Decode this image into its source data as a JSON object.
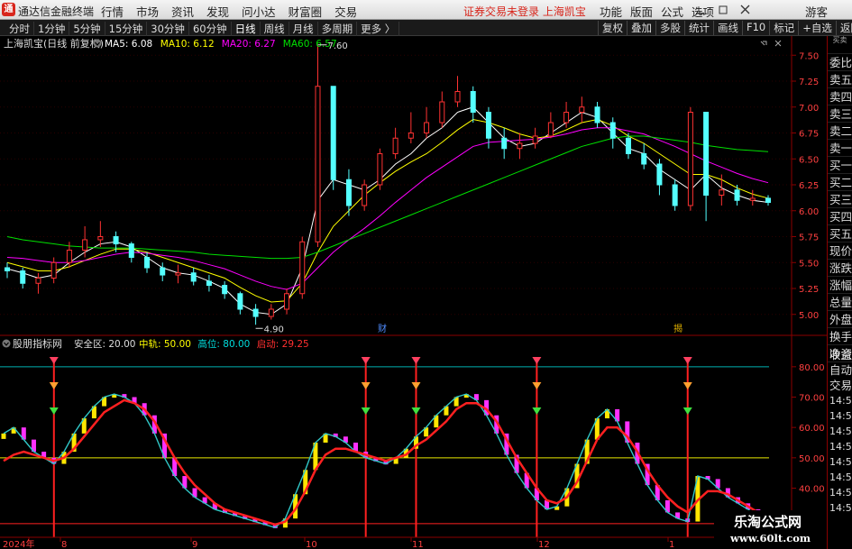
{
  "app": {
    "title": "通达信金融终端",
    "logo_char": "通"
  },
  "menu": [
    "行情",
    "市场",
    "资讯",
    "发现",
    "问小达",
    "财富圈",
    "交易"
  ],
  "status": {
    "text": "证券交易未登录  上海凯宝"
  },
  "right_menu": [
    "功能",
    "版面",
    "公式",
    "选项"
  ],
  "guest": "游客",
  "periods": [
    {
      "label": "分时",
      "active": false
    },
    {
      "label": "1分钟",
      "active": false
    },
    {
      "label": "5分钟",
      "active": false
    },
    {
      "label": "15分钟",
      "active": false
    },
    {
      "label": "30分钟",
      "active": false
    },
    {
      "label": "60分钟",
      "active": false
    },
    {
      "label": "日线",
      "active": true
    },
    {
      "label": "周线",
      "active": false
    },
    {
      "label": "月线",
      "active": false
    },
    {
      "label": "多周期",
      "active": false
    },
    {
      "label": "更多 〉",
      "active": false
    }
  ],
  "toolbar_right": [
    "复权",
    "叠加",
    "多股",
    "统计",
    "画线",
    "F10",
    "标记",
    "+自选",
    "返回"
  ],
  "price_panel": {
    "stock": "上海凯宝(日线 前复权)",
    "ma": [
      {
        "label": "MA5: 6.08",
        "color": "#ffffff"
      },
      {
        "label": "MA10: 6.12",
        "color": "#ffff00"
      },
      {
        "label": "MA20: 6.27",
        "color": "#ff00ff"
      },
      {
        "label": "MA60: 6.57",
        "color": "#00e000"
      }
    ],
    "high_label": "7.60",
    "low_label": "4.90",
    "markers": [
      "财",
      "揭"
    ],
    "yticks": [
      "7.50",
      "7.25",
      "7.00",
      "6.75",
      "6.50",
      "6.25",
      "6.00",
      "5.75",
      "5.50",
      "5.25",
      "5.00"
    ]
  },
  "indicator_panel": {
    "name": "股朋指标网",
    "params": [
      {
        "label": "安全区: 20.00",
        "color": "#dddddd"
      },
      {
        "label": "中轨: 50.00",
        "color": "#ffff00"
      },
      {
        "label": "高位: 80.00",
        "color": "#00dddd"
      },
      {
        "label": "启动: 29.25",
        "color": "#ff3030"
      }
    ],
    "yticks": [
      "80.00",
      "70.00",
      "60.00",
      "50.00",
      "40.00",
      "30.00"
    ]
  },
  "xaxis": [
    "2024年",
    "8",
    "9",
    "10",
    "11",
    "12",
    "1"
  ],
  "sidebar": {
    "top": "买卖",
    "items": [
      "委比",
      "卖五",
      "卖四",
      "卖三",
      "卖二",
      "卖一",
      "买一",
      "买二",
      "买三",
      "买四",
      "买五",
      "现价",
      "涨跌",
      "涨幅",
      "总量",
      "外盘",
      "换手",
      "净资",
      "收益"
    ],
    "lower": [
      "自动",
      "交易"
    ],
    "times": [
      "14:56",
      "14:56",
      "14:56",
      "14:56",
      "14:56",
      "14:56",
      "14:56",
      "14:56",
      "14:56"
    ]
  },
  "watermark": {
    "line1": "乐淘公式网",
    "line2": "www.60lt.com"
  },
  "chart_data": [
    {
      "type": "candlestick",
      "title": "上海凯宝(日线 前复权)",
      "ylim": [
        4.85,
        7.65
      ],
      "annotations": [
        {
          "text": "7.60",
          "point": "high"
        },
        {
          "text": "4.90",
          "point": "low"
        }
      ],
      "series": [
        {
          "name": "MA5",
          "color": "#ffffff",
          "values": [
            5.44,
            5.4,
            5.35,
            5.38,
            5.5,
            5.6,
            5.68,
            5.7,
            5.65,
            5.55,
            5.45,
            5.4,
            5.38,
            5.32,
            5.25,
            5.1,
            5.02,
            5.0,
            5.1,
            5.45,
            6.1,
            6.3,
            6.25,
            6.2,
            6.3,
            6.45,
            6.55,
            6.7,
            6.8,
            6.95,
            7.0,
            6.85,
            6.7,
            6.62,
            6.65,
            6.75,
            6.85,
            6.95,
            6.9,
            6.75,
            6.6,
            6.55,
            6.4,
            6.3,
            6.2,
            6.35,
            6.22,
            6.15,
            6.1,
            6.08
          ]
        },
        {
          "name": "MA10",
          "color": "#ffff00",
          "values": [
            5.5,
            5.46,
            5.42,
            5.42,
            5.46,
            5.52,
            5.58,
            5.63,
            5.63,
            5.6,
            5.55,
            5.5,
            5.45,
            5.4,
            5.35,
            5.26,
            5.18,
            5.12,
            5.13,
            5.3,
            5.6,
            5.85,
            6.0,
            6.15,
            6.27,
            6.38,
            6.47,
            6.55,
            6.66,
            6.78,
            6.88,
            6.85,
            6.8,
            6.74,
            6.7,
            6.72,
            6.78,
            6.85,
            6.88,
            6.82,
            6.72,
            6.65,
            6.55,
            6.45,
            6.35,
            6.35,
            6.3,
            6.22,
            6.16,
            6.12
          ]
        },
        {
          "name": "MA20",
          "color": "#ff00ff",
          "values": [
            5.55,
            5.54,
            5.52,
            5.5,
            5.5,
            5.52,
            5.55,
            5.58,
            5.6,
            5.59,
            5.57,
            5.55,
            5.52,
            5.48,
            5.44,
            5.38,
            5.32,
            5.27,
            5.24,
            5.3,
            5.45,
            5.6,
            5.72,
            5.83,
            5.95,
            6.08,
            6.2,
            6.32,
            6.42,
            6.52,
            6.62,
            6.66,
            6.67,
            6.68,
            6.69,
            6.71,
            6.74,
            6.78,
            6.8,
            6.8,
            6.77,
            6.74,
            6.68,
            6.62,
            6.55,
            6.48,
            6.42,
            6.36,
            6.31,
            6.27
          ]
        },
        {
          "name": "MA60",
          "color": "#00e000",
          "values": [
            5.75,
            5.72,
            5.7,
            5.68,
            5.66,
            5.65,
            5.64,
            5.64,
            5.64,
            5.63,
            5.62,
            5.61,
            5.6,
            5.58,
            5.57,
            5.56,
            5.55,
            5.54,
            5.54,
            5.55,
            5.6,
            5.66,
            5.72,
            5.78,
            5.84,
            5.9,
            5.96,
            6.02,
            6.08,
            6.14,
            6.2,
            6.26,
            6.32,
            6.38,
            6.44,
            6.5,
            6.56,
            6.62,
            6.66,
            6.7,
            6.72,
            6.72,
            6.7,
            6.68,
            6.66,
            6.63,
            6.61,
            6.59,
            6.58,
            6.57
          ]
        }
      ],
      "candles": [
        {
          "o": 5.45,
          "c": 5.42,
          "h": 5.5,
          "l": 5.35
        },
        {
          "o": 5.42,
          "c": 5.3,
          "h": 5.45,
          "l": 5.25
        },
        {
          "o": 5.3,
          "c": 5.35,
          "h": 5.4,
          "l": 5.2
        },
        {
          "o": 5.35,
          "c": 5.5,
          "h": 5.55,
          "l": 5.3
        },
        {
          "o": 5.5,
          "c": 5.62,
          "h": 5.7,
          "l": 5.45
        },
        {
          "o": 5.62,
          "c": 5.72,
          "h": 5.85,
          "l": 5.55
        },
        {
          "o": 5.72,
          "c": 5.75,
          "h": 5.9,
          "l": 5.65
        },
        {
          "o": 5.75,
          "c": 5.68,
          "h": 5.8,
          "l": 5.6
        },
        {
          "o": 5.68,
          "c": 5.55,
          "h": 5.7,
          "l": 5.5
        },
        {
          "o": 5.55,
          "c": 5.45,
          "h": 5.6,
          "l": 5.4
        },
        {
          "o": 5.45,
          "c": 5.38,
          "h": 5.5,
          "l": 5.32
        },
        {
          "o": 5.38,
          "c": 5.4,
          "h": 5.48,
          "l": 5.3
        },
        {
          "o": 5.4,
          "c": 5.32,
          "h": 5.45,
          "l": 5.28
        },
        {
          "o": 5.32,
          "c": 5.28,
          "h": 5.38,
          "l": 5.22
        },
        {
          "o": 5.28,
          "c": 5.2,
          "h": 5.32,
          "l": 5.15
        },
        {
          "o": 5.2,
          "c": 5.05,
          "h": 5.22,
          "l": 5.0
        },
        {
          "o": 5.05,
          "c": 4.98,
          "h": 5.1,
          "l": 4.9
        },
        {
          "o": 4.98,
          "c": 5.05,
          "h": 5.1,
          "l": 4.95
        },
        {
          "o": 5.05,
          "c": 5.2,
          "h": 5.25,
          "l": 5.0
        },
        {
          "o": 5.2,
          "c": 5.7,
          "h": 5.75,
          "l": 5.15
        },
        {
          "o": 5.7,
          "c": 7.2,
          "h": 7.6,
          "l": 5.65
        },
        {
          "o": 7.2,
          "c": 6.3,
          "h": 7.2,
          "l": 6.2
        },
        {
          "o": 6.3,
          "c": 6.05,
          "h": 6.4,
          "l": 5.95
        },
        {
          "o": 6.05,
          "c": 6.25,
          "h": 6.3,
          "l": 6.0
        },
        {
          "o": 6.25,
          "c": 6.55,
          "h": 6.6,
          "l": 6.2
        },
        {
          "o": 6.55,
          "c": 6.7,
          "h": 6.8,
          "l": 6.5
        },
        {
          "o": 6.7,
          "c": 6.75,
          "h": 6.95,
          "l": 6.65
        },
        {
          "o": 6.75,
          "c": 6.85,
          "h": 7.0,
          "l": 6.7
        },
        {
          "o": 6.85,
          "c": 7.05,
          "h": 7.15,
          "l": 6.8
        },
        {
          "o": 7.05,
          "c": 7.15,
          "h": 7.3,
          "l": 7.0
        },
        {
          "o": 7.15,
          "c": 6.95,
          "h": 7.2,
          "l": 6.85
        },
        {
          "o": 6.95,
          "c": 6.7,
          "h": 7.0,
          "l": 6.6
        },
        {
          "o": 6.7,
          "c": 6.6,
          "h": 6.8,
          "l": 6.5
        },
        {
          "o": 6.6,
          "c": 6.65,
          "h": 6.75,
          "l": 6.5
        },
        {
          "o": 6.65,
          "c": 6.72,
          "h": 6.8,
          "l": 6.6
        },
        {
          "o": 6.72,
          "c": 6.85,
          "h": 6.95,
          "l": 6.7
        },
        {
          "o": 6.85,
          "c": 6.95,
          "h": 7.05,
          "l": 6.8
        },
        {
          "o": 6.95,
          "c": 7.0,
          "h": 7.1,
          "l": 6.85
        },
        {
          "o": 7.0,
          "c": 6.85,
          "h": 7.05,
          "l": 6.8
        },
        {
          "o": 6.85,
          "c": 6.7,
          "h": 6.9,
          "l": 6.6
        },
        {
          "o": 6.7,
          "c": 6.55,
          "h": 6.75,
          "l": 6.5
        },
        {
          "o": 6.55,
          "c": 6.45,
          "h": 6.65,
          "l": 6.4
        },
        {
          "o": 6.45,
          "c": 6.25,
          "h": 6.5,
          "l": 6.15
        },
        {
          "o": 6.25,
          "c": 6.05,
          "h": 6.3,
          "l": 6.0
        },
        {
          "o": 6.05,
          "c": 6.95,
          "h": 7.0,
          "l": 6.0
        },
        {
          "o": 6.95,
          "c": 6.15,
          "h": 6.95,
          "l": 5.9
        },
        {
          "o": 6.15,
          "c": 6.2,
          "h": 6.35,
          "l": 6.05
        },
        {
          "o": 6.2,
          "c": 6.1,
          "h": 6.25,
          "l": 6.05
        },
        {
          "o": 6.1,
          "c": 6.12,
          "h": 6.2,
          "l": 6.05
        },
        {
          "o": 6.12,
          "c": 6.08,
          "h": 6.15,
          "l": 6.05
        }
      ]
    },
    {
      "type": "bar",
      "title": "股朋指标网",
      "ylim": [
        25,
        85
      ],
      "hlines": [
        {
          "name": "中轨",
          "value": 50
        },
        {
          "name": "高位",
          "value": 80
        }
      ],
      "series": [
        {
          "name": "fast",
          "values": [
            58,
            60,
            56,
            52,
            50,
            48,
            52,
            58,
            63,
            67,
            70,
            71,
            70,
            68,
            64,
            58,
            50,
            44,
            40,
            37,
            35,
            33,
            32,
            31,
            30,
            29,
            28,
            27,
            30,
            38,
            46,
            55,
            58,
            57,
            55,
            52,
            50,
            49,
            48,
            50,
            53,
            57,
            60,
            64,
            67,
            70,
            71,
            69,
            64,
            58,
            51,
            45,
            40,
            36,
            33,
            34,
            40,
            48,
            56,
            63,
            66,
            62,
            55,
            48,
            41,
            36,
            32,
            30,
            29,
            44,
            43,
            40,
            37,
            35,
            33,
            31,
            29
          ]
        },
        {
          "name": "slow",
          "values": [
            49,
            51,
            52,
            51,
            50,
            49,
            50,
            53,
            57,
            61,
            65,
            67,
            69,
            68,
            66,
            62,
            56,
            50,
            45,
            41,
            38,
            35,
            33,
            32,
            31,
            30,
            29,
            28,
            29,
            33,
            39,
            46,
            51,
            53,
            53,
            52,
            51,
            50,
            49,
            50,
            51,
            54,
            56,
            59,
            62,
            66,
            68,
            68,
            66,
            62,
            56,
            50,
            45,
            40,
            36,
            35,
            37,
            42,
            49,
            56,
            60,
            60,
            57,
            52,
            46,
            41,
            37,
            34,
            32,
            36,
            39,
            39,
            38,
            36,
            34,
            32,
            30
          ]
        }
      ]
    }
  ]
}
